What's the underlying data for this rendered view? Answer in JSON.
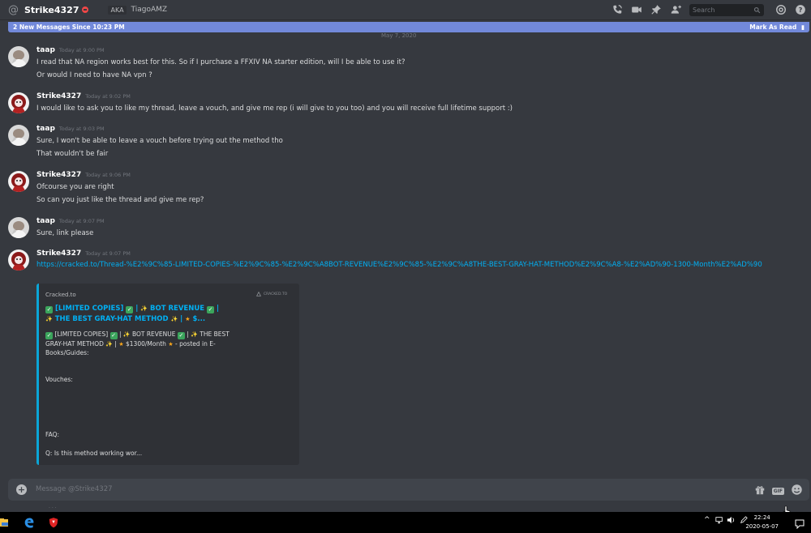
{
  "header": {
    "channel_name": "Strike4327",
    "aka_tag": "AKA",
    "aka_name": "TiagoAMZ",
    "search_placeholder": "Search"
  },
  "new_messages": {
    "label": "2 New Messages Since 10:23 PM",
    "mark_read": "Mark As Read"
  },
  "date_divider": "May 7, 2020",
  "messages": [
    {
      "author": "taap",
      "time": "Today at 9:00 PM",
      "lines": [
        "I read that NA region works best for this. So if I purchase a FFXIV NA starter edition, will I be able to use it?",
        "Or would I need to have NA vpn ?"
      ]
    },
    {
      "author": "Strike4327",
      "time": "Today at 9:02 PM",
      "lines": [
        "I would like to ask you to like my thread, leave a vouch, and give me rep (i will give to you too) and you will receive full lifetime support :)"
      ]
    },
    {
      "author": "taap",
      "time": "Today at 9:03 PM",
      "lines": [
        "Sure, I won't be able to leave a vouch before trying out the method tho",
        "That wouldn't be fair"
      ]
    },
    {
      "author": "Strike4327",
      "time": "Today at 9:06 PM",
      "lines": [
        "Ofcourse you are right",
        "So can you just like the thread and give me rep?"
      ]
    },
    {
      "author": "taap",
      "time": "Today at 9:07 PM",
      "lines": [
        "Sure, link please"
      ]
    },
    {
      "author": "Strike4327",
      "time": "Today at 9:07 PM",
      "link": "https://cracked.to/Thread-%E2%9C%85-LIMITED-COPIES-%E2%9C%85-%E2%9C%A8BOT-REVENUE%E2%9C%85-%E2%9C%A8THE-BEST-GRAY-HAT-METHOD%E2%9C%A8-%E2%AD%90-1300-Month%E2%AD%90"
    }
  ],
  "embed": {
    "provider": "Cracked.to",
    "thumb_text": "CRACKED.TO",
    "title_line1": "[LIMITED COPIES]",
    "title_part2": "BOT REVENUE",
    "title_line2": "THE BEST GRAY-HAT METHOD",
    "title_end": "$...",
    "desc_line1a": "[LIMITED COPIES]",
    "desc_line1b": "BOT REVENUE",
    "desc_line1c": "THE BEST",
    "desc_line2a": "GRAY-HAT METHOD",
    "desc_line2b": "$1300/Month",
    "desc_line2c": "- posted in E-",
    "desc_line3": "Books/Guides:",
    "vouches": "Vouches:",
    "faq": "FAQ:",
    "question": "Q: Is this method working wor..."
  },
  "composer": {
    "placeholder": "Message @Strike4327",
    "gif_label": "GIF"
  },
  "taskbar": {
    "time": "22:24",
    "date": "2020-05-07"
  },
  "colors": {
    "accent": "#7289da",
    "link": "#00b0f4",
    "embed_border": "#0aa6d8",
    "dnd": "#f04747",
    "background": "#36393f"
  }
}
